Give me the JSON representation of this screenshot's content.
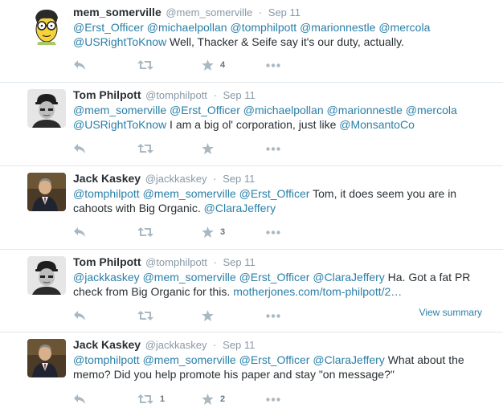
{
  "tweets": [
    {
      "fullname": "mem_somerville",
      "handle": "@mem_somerville",
      "sep": "·",
      "date": "Sep 11",
      "line1": [
        {
          "t": "@Erst_Officer",
          "m": true
        },
        {
          "t": " "
        },
        {
          "t": "@michaelpollan",
          "m": true
        },
        {
          "t": " "
        },
        {
          "t": "@tomphilpott",
          "m": true
        },
        {
          "t": " "
        },
        {
          "t": "@marionnestle",
          "m": true
        },
        {
          "t": " "
        },
        {
          "t": "@mercola",
          "m": true
        }
      ],
      "line2": [
        {
          "t": "@USRightToKnow",
          "m": true
        },
        {
          "t": " Well, Thacker & Seife say it's our duty, actually."
        }
      ],
      "retweet_count": "",
      "favorite_count": "4"
    },
    {
      "fullname": "Tom Philpott",
      "handle": "@tomphilpott",
      "sep": "·",
      "date": "Sep 11",
      "line1": [
        {
          "t": "@mem_somerville",
          "m": true
        },
        {
          "t": " "
        },
        {
          "t": "@Erst_Officer",
          "m": true
        },
        {
          "t": " "
        },
        {
          "t": "@michaelpollan",
          "m": true
        },
        {
          "t": " "
        },
        {
          "t": "@marionnestle",
          "m": true
        },
        {
          "t": " "
        },
        {
          "t": "@mercola",
          "m": true
        }
      ],
      "line2": [
        {
          "t": "@USRightToKnow",
          "m": true
        },
        {
          "t": " I am a big ol' corporation, just like "
        },
        {
          "t": "@MonsantoCo",
          "m": true
        }
      ],
      "retweet_count": "",
      "favorite_count": ""
    },
    {
      "fullname": "Jack Kaskey",
      "handle": "@jackkaskey",
      "sep": "·",
      "date": "Sep 11",
      "line1": [
        {
          "t": "@tomphilpott",
          "m": true
        },
        {
          "t": " "
        },
        {
          "t": "@mem_somerville",
          "m": true
        },
        {
          "t": " "
        },
        {
          "t": "@Erst_Officer",
          "m": true
        },
        {
          "t": "  Tom, it does seem you are in"
        }
      ],
      "line2": [
        {
          "t": "cahoots with Big Organic. "
        },
        {
          "t": "@ClaraJeffery",
          "m": true
        }
      ],
      "retweet_count": "",
      "favorite_count": "3"
    },
    {
      "fullname": "Tom Philpott",
      "handle": "@tomphilpott",
      "sep": "·",
      "date": "Sep 11",
      "line1": [
        {
          "t": "@jackkaskey",
          "m": true
        },
        {
          "t": " "
        },
        {
          "t": "@mem_somerville",
          "m": true
        },
        {
          "t": " "
        },
        {
          "t": "@Erst_Officer",
          "m": true
        },
        {
          "t": " "
        },
        {
          "t": "@ClaraJeffery",
          "m": true
        },
        {
          "t": " Ha. Got a fat PR"
        }
      ],
      "line2": [
        {
          "t": "check from  Big Organic for this.  "
        },
        {
          "t": "motherjones.com/tom-philpott/2…",
          "m": true
        }
      ],
      "view_summary": "View summary",
      "retweet_count": "",
      "favorite_count": ""
    },
    {
      "fullname": "Jack Kaskey",
      "handle": "@jackkaskey",
      "sep": "·",
      "date": "Sep 11",
      "line1": [
        {
          "t": "@tomphilpott",
          "m": true
        },
        {
          "t": " "
        },
        {
          "t": "@mem_somerville",
          "m": true
        },
        {
          "t": " "
        },
        {
          "t": "@Erst_Officer",
          "m": true
        },
        {
          "t": " "
        },
        {
          "t": "@ClaraJeffery",
          "m": true
        },
        {
          "t": " What about the"
        }
      ],
      "line2": [
        {
          "t": "memo? Did you help promote his paper and stay \"on message?\""
        }
      ],
      "retweet_count": "1",
      "favorite_count": "2"
    }
  ],
  "icons": {
    "reply": "reply-arrow-icon",
    "retweet": "retweet-icon",
    "favorite": "star-icon",
    "more": "more-dots-icon"
  },
  "colors": {
    "link": "#2a7fa8",
    "icon": "#aab8c2",
    "text": "#292f33",
    "meta": "#8899a6",
    "divider": "#e1e8ed"
  }
}
